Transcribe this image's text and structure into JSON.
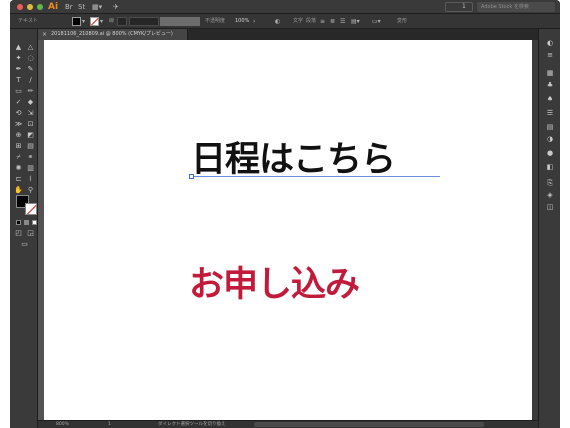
{
  "app": {
    "logo": "Ai"
  },
  "menubar": {
    "workspace_value": "1",
    "stock_search_placeholder": "Adobe Stock を検索"
  },
  "controlbar": {
    "selection_type": "テキスト",
    "stroke_label": "線",
    "opacity_label": "不透明度",
    "opacity_value": "100%",
    "char_label": "文字",
    "para_label": "段落",
    "transform_label": "変形"
  },
  "document": {
    "tab_title": "20181106_210809.ai @ 800% (CMYK/プレビュー)"
  },
  "artboard": {
    "headline": "日程はこちら",
    "cta_text": "お申し込み",
    "cta_color": "#c21a3a",
    "selection_color": "#3b6be0"
  },
  "statusbar": {
    "zoom": "800%",
    "page": "1",
    "tool_hint": "ダイレクト選択ツールを切り換え"
  },
  "icons": {
    "close": "×",
    "tools": [
      "▲",
      "△",
      "✒",
      "✎",
      "T",
      "/",
      "▭",
      "✏",
      "◌",
      "✂",
      "⟲",
      "⇲",
      "✋",
      "🔍"
    ],
    "right": [
      "◐",
      "≡",
      "▦",
      "♣",
      "☰",
      "▤",
      "●",
      "◧",
      "▣",
      "⊙",
      "⎘",
      "◫"
    ]
  }
}
